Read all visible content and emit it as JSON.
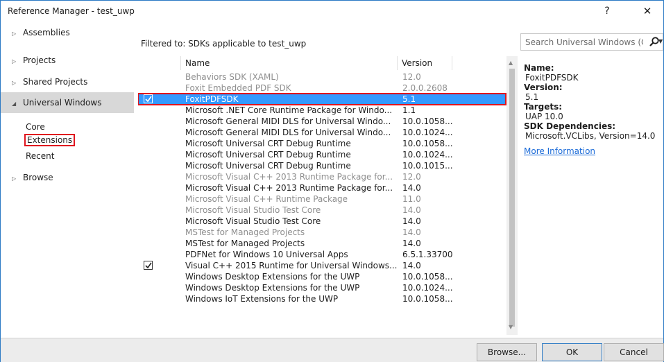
{
  "window": {
    "title": "Reference Manager - test_uwp",
    "help": "?",
    "close": "✕"
  },
  "nav": {
    "items": [
      {
        "label": "Assemblies",
        "arrow": "▷"
      },
      {
        "label": "Projects",
        "arrow": "▷"
      },
      {
        "label": "Shared Projects",
        "arrow": "▷"
      },
      {
        "label": "Universal Windows",
        "arrow": "◢"
      },
      {
        "label": "Browse",
        "arrow": "▷"
      }
    ],
    "sub": [
      "Core",
      "Extensions",
      "Recent"
    ]
  },
  "filter_text": "Filtered to: SDKs applicable to test_uwp",
  "search": {
    "placeholder": "Search Universal Windows (C"
  },
  "grid": {
    "columns": [
      "Name",
      "Version"
    ],
    "rows": [
      {
        "name": "Behaviors SDK (XAML)",
        "version": "12.0",
        "checked": false,
        "dim": true
      },
      {
        "name": "Foxit Embedded PDF SDK",
        "version": "2.0.0.2608",
        "checked": false,
        "dim": true
      },
      {
        "name": "FoxitPDFSDK",
        "version": "5.1",
        "checked": true,
        "dim": false,
        "selected": true
      },
      {
        "name": "Microsoft .NET Core Runtime Package for Windo...",
        "version": "1.1",
        "checked": false,
        "dim": false
      },
      {
        "name": "Microsoft General MIDI DLS for Universal Windo...",
        "version": "10.0.1058...",
        "checked": false,
        "dim": false
      },
      {
        "name": "Microsoft General MIDI DLS for Universal Windo...",
        "version": "10.0.1024...",
        "checked": false,
        "dim": false
      },
      {
        "name": "Microsoft Universal CRT Debug Runtime",
        "version": "10.0.1058...",
        "checked": false,
        "dim": false
      },
      {
        "name": "Microsoft Universal CRT Debug Runtime",
        "version": "10.0.1024...",
        "checked": false,
        "dim": false
      },
      {
        "name": "Microsoft Universal CRT Debug Runtime",
        "version": "10.0.1015...",
        "checked": false,
        "dim": false
      },
      {
        "name": "Microsoft Visual C++ 2013 Runtime Package for...",
        "version": "12.0",
        "checked": false,
        "dim": true
      },
      {
        "name": "Microsoft Visual C++ 2013 Runtime Package for...",
        "version": "14.0",
        "checked": false,
        "dim": false
      },
      {
        "name": "Microsoft Visual C++ Runtime Package",
        "version": "11.0",
        "checked": false,
        "dim": true
      },
      {
        "name": "Microsoft Visual Studio Test Core",
        "version": "14.0",
        "checked": false,
        "dim": true
      },
      {
        "name": "Microsoft Visual Studio Test Core",
        "version": "14.0",
        "checked": false,
        "dim": false
      },
      {
        "name": "MSTest for Managed Projects",
        "version": "14.0",
        "checked": false,
        "dim": true
      },
      {
        "name": "MSTest for Managed Projects",
        "version": "14.0",
        "checked": false,
        "dim": false
      },
      {
        "name": "PDFNet for Windows 10 Universal Apps",
        "version": "6.5.1.33700",
        "checked": false,
        "dim": false
      },
      {
        "name": "Visual C++ 2015 Runtime for Universal Windows...",
        "version": "14.0",
        "checked": true,
        "dim": false
      },
      {
        "name": "Windows Desktop Extensions for the UWP",
        "version": "10.0.1058...",
        "checked": false,
        "dim": false
      },
      {
        "name": "Windows Desktop Extensions for the UWP",
        "version": "10.0.1024...",
        "checked": false,
        "dim": false
      },
      {
        "name": "Windows IoT Extensions for the UWP",
        "version": "10.0.1058...",
        "checked": false,
        "dim": false
      }
    ]
  },
  "details": {
    "name_label": "Name:",
    "name_value": "FoxitPDFSDK",
    "version_label": "Version:",
    "version_value": "5.1",
    "targets_label": "Targets:",
    "targets_value": "UAP 10.0",
    "deps_label": "SDK Dependencies:",
    "deps_value": "Microsoft.VCLibs, Version=14.0",
    "more_link": "More Information"
  },
  "buttons": {
    "browse": "Browse...",
    "ok": "OK",
    "cancel": "Cancel"
  },
  "colors": {
    "accent": "#3399ff",
    "highlight_box": "#e0141e",
    "link": "#1a6ad8"
  }
}
